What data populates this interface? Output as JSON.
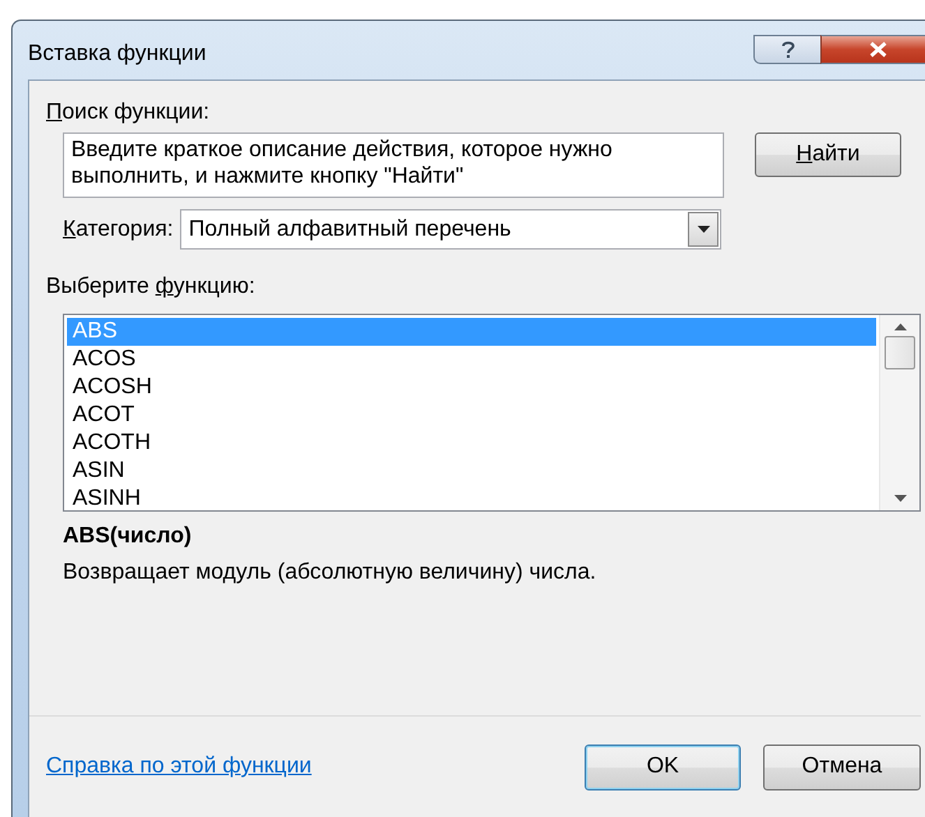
{
  "window": {
    "title": "Вставка функции"
  },
  "search": {
    "label": {
      "key": "П",
      "rest": "оиск функции:"
    },
    "value": "Введите краткое описание действия, которое нужно выполнить, и нажмите кнопку \"Найти\""
  },
  "find_button": {
    "label": {
      "key": "Н",
      "rest": "айти"
    }
  },
  "category": {
    "label": {
      "key": "К",
      "rest": "атегория:"
    },
    "value": "Полный алфавитный перечень"
  },
  "function_list": {
    "label": {
      "before": "Выберите ",
      "key": "ф",
      "rest": "ункцию:"
    },
    "items": [
      {
        "name": "ABS",
        "selected": true
      },
      {
        "name": "ACOS",
        "selected": false
      },
      {
        "name": "ACOSH",
        "selected": false
      },
      {
        "name": "ACOT",
        "selected": false
      },
      {
        "name": "ACOTH",
        "selected": false
      },
      {
        "name": "ASIN",
        "selected": false
      },
      {
        "name": "ASINH",
        "selected": false
      }
    ]
  },
  "syntax": "ABS(число)",
  "description": "Возвращает модуль (абсолютную величину) числа.",
  "help_link": "Справка по этой функции",
  "buttons": [
    {
      "label": "OK",
      "default": true
    },
    {
      "label": "Отмена",
      "default": false
    }
  ]
}
